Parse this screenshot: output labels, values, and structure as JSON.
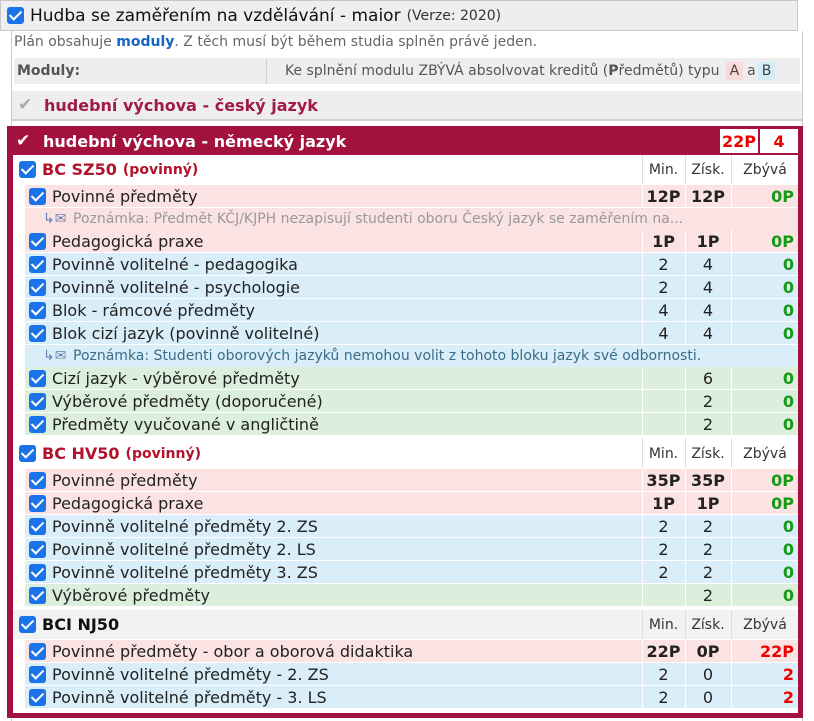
{
  "header": {
    "title": "Hudba se zaměřením na vzdělávání - maior",
    "version": "(Verze: 2020)"
  },
  "info": {
    "prefix": "Plán obsahuje ",
    "highlight": "moduly",
    "suffix": ". Z těch musí být během studia splněn právě jeden."
  },
  "modules_header": {
    "label": "Moduly:",
    "note_prefix": "Ke splnění modulu ZBÝVÁ absolvovat kreditů (",
    "note_bold": "P",
    "note_suffix": "ředmětů) typu",
    "type_a": "A",
    "and": "a",
    "type_b": "B"
  },
  "module1": {
    "check": "✔",
    "name": "hudební výchova - český jazyk"
  },
  "module2": {
    "check": "✔",
    "name": "hudební výchova - německý jazyk",
    "credits": "22P",
    "count": "4"
  },
  "columns": {
    "min": "Min.",
    "got": "Získ.",
    "left": "Zbývá"
  },
  "groups": [
    {
      "name": "BC SZ50",
      "tag": "(povinný)",
      "rows": [
        {
          "label": "Povinné předměty",
          "type": "A",
          "min": "12P",
          "got": "12P",
          "left": "0P",
          "state": "ok"
        },
        {
          "note": "Poznámka: Předmět KČJ/KJPH nezapisují studenti oboru Český jazyk se zaměřením na...",
          "type": "A"
        },
        {
          "label": "Pedagogická praxe",
          "type": "A",
          "min": "1P",
          "got": "1P",
          "left": "0P",
          "state": "ok"
        },
        {
          "label": "Povinně volitelné - pedagogika",
          "type": "B",
          "min": "2",
          "got": "4",
          "left": "0",
          "state": "ok"
        },
        {
          "label": "Povinně volitelné - psychologie",
          "type": "B",
          "min": "2",
          "got": "4",
          "left": "0",
          "state": "ok"
        },
        {
          "label": "Blok - rámcové předměty",
          "type": "B",
          "min": "4",
          "got": "4",
          "left": "0",
          "state": "ok"
        },
        {
          "label": "Blok cizí jazyk (povinně volitelné)",
          "type": "B",
          "min": "4",
          "got": "4",
          "left": "0",
          "state": "ok"
        },
        {
          "note": "Poznámka: Studenti oborových jazyků nemohou volit z tohoto bloku jazyk své odbornosti.",
          "type": "B"
        },
        {
          "label": "Cizí jazyk - výběrové předměty",
          "type": "C",
          "min": "",
          "got": "6",
          "left": "0",
          "state": "ok"
        },
        {
          "label": "Výběrové předměty (doporučené)",
          "type": "C",
          "min": "",
          "got": "2",
          "left": "0",
          "state": "ok"
        },
        {
          "label": "Předměty vyučované v angličtině",
          "type": "C",
          "min": "",
          "got": "2",
          "left": "0",
          "state": "ok"
        }
      ]
    },
    {
      "name": "BC HV50",
      "tag": "(povinný)",
      "rows": [
        {
          "label": "Povinné předměty",
          "type": "A",
          "min": "35P",
          "got": "35P",
          "left": "0P",
          "state": "ok"
        },
        {
          "label": "Pedagogická praxe",
          "type": "A",
          "min": "1P",
          "got": "1P",
          "left": "0P",
          "state": "ok"
        },
        {
          "label": "Povinně volitelné předměty 2. ZS",
          "type": "B",
          "min": "2",
          "got": "2",
          "left": "0",
          "state": "ok"
        },
        {
          "label": "Povinně volitelné předměty 2. LS",
          "type": "B",
          "min": "2",
          "got": "2",
          "left": "0",
          "state": "ok"
        },
        {
          "label": "Povinně volitelné předměty 3. ZS",
          "type": "B",
          "min": "2",
          "got": "2",
          "left": "0",
          "state": "ok"
        },
        {
          "label": "Výběrové předměty",
          "type": "C",
          "min": "",
          "got": "2",
          "left": "0",
          "state": "ok"
        }
      ]
    },
    {
      "name": "BCI NJ50",
      "tag": "",
      "rows": [
        {
          "label": "Povinné předměty - obor a oborová didaktika",
          "type": "A",
          "min": "22P",
          "got": "0P",
          "left": "22P",
          "state": "bad"
        },
        {
          "label": "Povinně volitelné předměty - 2. ZS",
          "type": "B",
          "min": "2",
          "got": "0",
          "left": "2",
          "state": "bad"
        },
        {
          "label": "Povinně volitelné předměty - 3. LS",
          "type": "B",
          "min": "2",
          "got": "0",
          "left": "2",
          "state": "bad"
        }
      ]
    }
  ]
}
